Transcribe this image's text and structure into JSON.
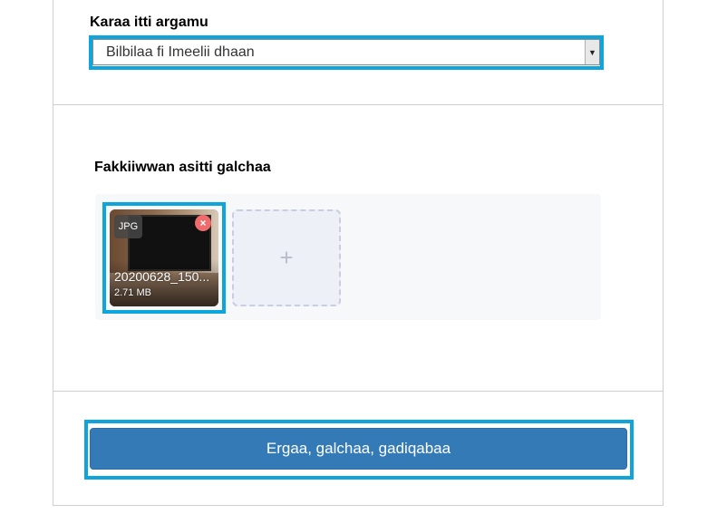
{
  "contact": {
    "label": "Karaa itti argamu",
    "selected": "Bilbilaa fi Imeelii dhaan"
  },
  "upload": {
    "label": "Fakkiiwwan asitti galchaa",
    "file": {
      "type": "JPG",
      "name": "20200628_150...",
      "size": "2.71 MB",
      "remove_symbol": "×"
    },
    "add_symbol": "+"
  },
  "submit": {
    "label": "Ergaa, galchaa, gadiqabaa"
  },
  "colors": {
    "highlight": "#0ea5dd",
    "primary_button": "#337ab7",
    "remove_badge": "#f06b6b"
  }
}
